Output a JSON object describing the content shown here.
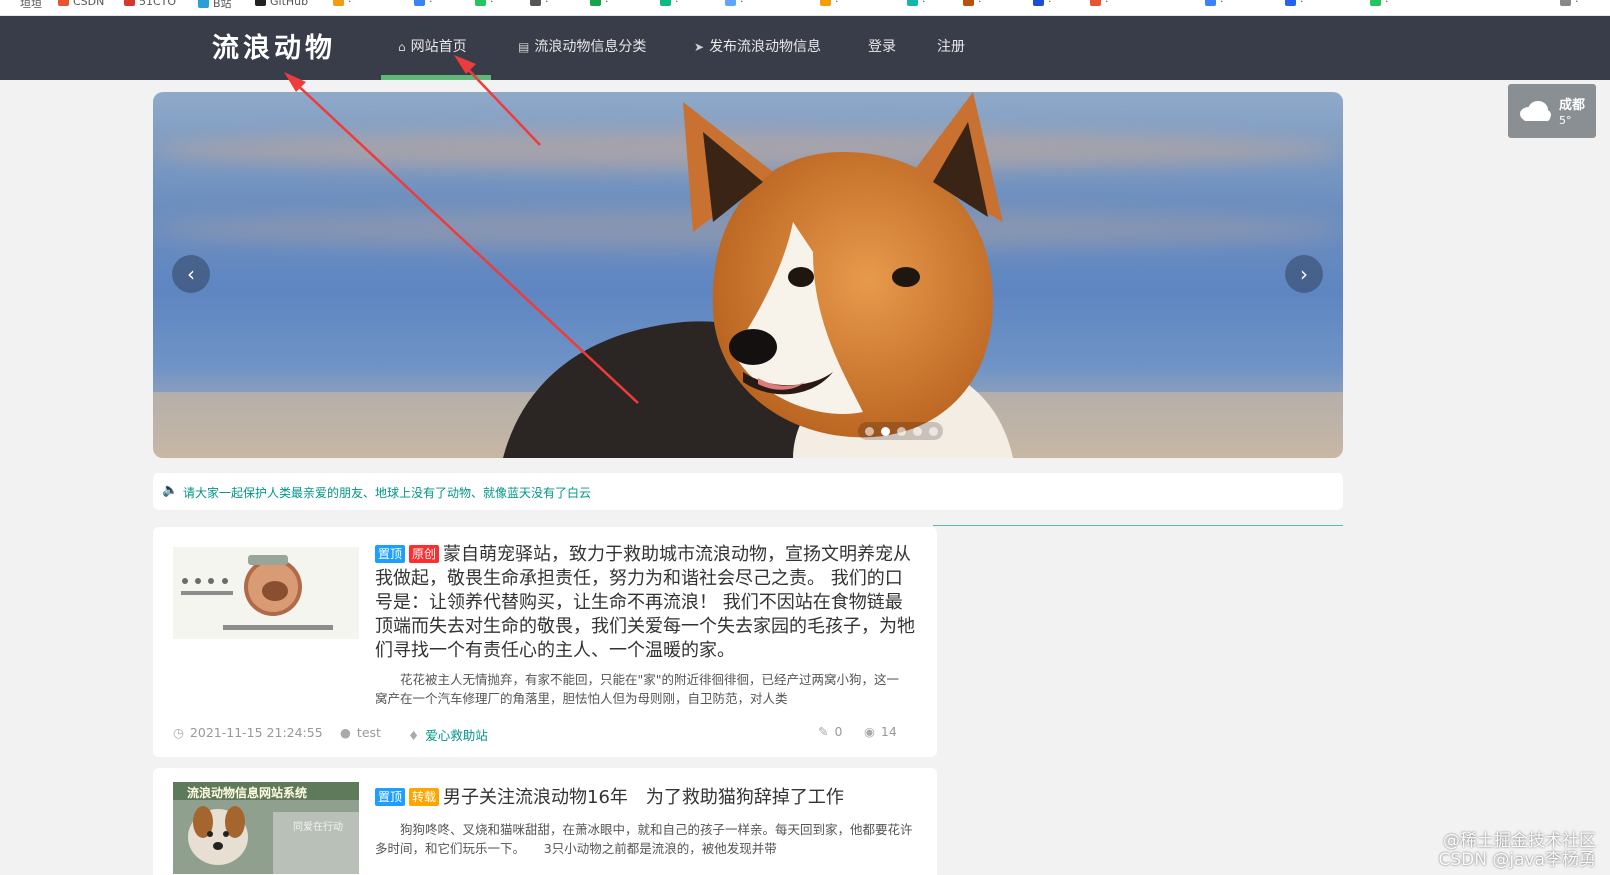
{
  "site": {
    "logo": "流浪动物",
    "nav": [
      {
        "label": "网站首页",
        "icon": "home-icon",
        "active": true
      },
      {
        "label": "流浪动物信息分类",
        "icon": "document-icon",
        "active": false
      },
      {
        "label": "发布流浪动物信息",
        "icon": "paper-plane-icon",
        "active": false
      },
      {
        "label": "登录",
        "icon": "",
        "active": false
      },
      {
        "label": "注册",
        "icon": "",
        "active": false
      }
    ]
  },
  "weather": {
    "city": "成都",
    "temp": "5°",
    "icon": "cloud-icon"
  },
  "carousel": {
    "slide_count": 5,
    "active_index": 1,
    "prev_icon": "chevron-left-icon",
    "next_icon": "chevron-right-icon"
  },
  "notice": {
    "icon": "speaker-icon",
    "text": "请大家一起保护人类最亲爱的朋友、地球上没有了动物、就像蓝天没有了白云"
  },
  "articles": [
    {
      "badges": [
        "置顶",
        "原创"
      ],
      "title": "蒙自萌宠驿站，致力于救助城市流浪动物，宣扬文明养宠从我做起，敬畏生命承担责任，努力为和谐社会尽己之责。 我们的口号是：让领养代替购买，让生命不再流浪！ 我们不因站在食物链最顶端而失去对生命的敬畏，我们关爱每一个失去家园的毛孩子，为牠们寻找一个有责任心的主人、一个温暖的家。",
      "summary": "花花被主人无情抛弃，有家不能回，只能在\"家\"的附近徘徊徘徊，已经产过两窝小狗，这一窝产在一个汽车修理厂的角落里，胆怯怕人但为母则刚，自卫防范，对人类",
      "date": "2021-11-15 21:24:55",
      "author": "test",
      "category": "爱心救助站",
      "comments": "0",
      "views": "14"
    },
    {
      "badges": [
        "置顶",
        "转载"
      ],
      "title": "男子关注流浪动物16年　为了救助猫狗辞掉了工作",
      "summary": "狗狗咚咚、叉烧和猫咪甜甜，在萧冰眼中，就和自己的孩子一样亲。每天回到家，他都要花许多时间，和它们玩乐一下。　　3只小动物之前都是流浪的，被他发现并带",
      "thumb_caption": "流浪动物信息网站系统",
      "thumb_subcaption": "同爱在行动"
    }
  ],
  "watermark": [
    "@稀土掘金技术社区",
    "CSDN @java李杨勇"
  ]
}
